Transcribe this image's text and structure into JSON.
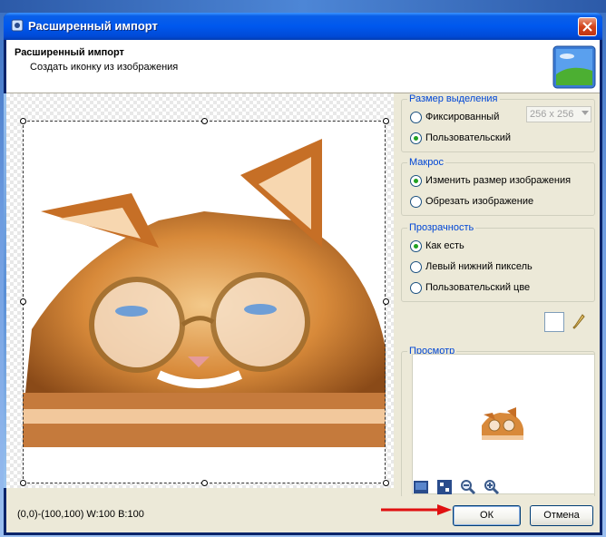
{
  "window": {
    "title": "Расширенный импорт"
  },
  "header": {
    "title": "Расширенный импорт",
    "subtitle": "Создать иконку из изображения"
  },
  "groups": {
    "selection_size": {
      "title": "Размер выделения",
      "options": [
        "Фиксированный",
        "Пользовательский"
      ],
      "selected": 1,
      "fixed_value": "256 x 256"
    },
    "macros": {
      "title": "Макрос",
      "options": [
        "Изменить размер изображения",
        "Обрезать изображение"
      ],
      "selected": 0
    },
    "transparency": {
      "title": "Прозрачность",
      "options": [
        "Как есть",
        "Левый нижний пиксель",
        "Пользовательский цве"
      ],
      "selected": 0
    },
    "preview": {
      "title": "Просмотр"
    }
  },
  "status": {
    "coords": "(0,0)-(100,100) W:100 В:100"
  },
  "buttons": {
    "ok": "ОК",
    "cancel": "Отмена"
  },
  "colors": {
    "title_bar": "#0058ee",
    "group_title": "#0046d5",
    "radio_checked": "#21a121",
    "annotation_arrow": "#e01010"
  },
  "icons": [
    "app-icon",
    "close-icon",
    "windows-xp-logo-icon",
    "eyedropper-icon",
    "fit-icon",
    "actual-size-icon",
    "zoom-out-icon",
    "zoom-in-icon"
  ]
}
